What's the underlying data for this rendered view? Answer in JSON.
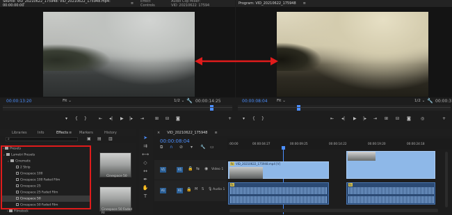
{
  "source_monitor": {
    "tabs": [
      "Source: VID_20210622_175948: VID_20210622_175948.mp4: 00:00:00:00",
      "Effect Controls",
      "Audio Clip Mixer: VID_20210622_17594"
    ],
    "timecode_current": "00:00:13:20",
    "fit": "Fit",
    "resolution": "1/2",
    "timecode_duration": "00:00:14:25"
  },
  "program_monitor": {
    "title": "Program: VID_20210622_175948",
    "timecode_current": "00:00:08:04",
    "fit": "Fit",
    "resolution": "1/2",
    "timecode_duration": "00:00:3"
  },
  "arrow_color": "#e01b1b",
  "effects_panel": {
    "tabs": [
      "Libraries",
      "Info",
      "Effects",
      "Markers",
      "History"
    ],
    "tree": [
      {
        "label": "Presets",
        "level": 0,
        "type": "folder"
      },
      {
        "label": "Lumetri Presets",
        "level": 0,
        "type": "folder"
      },
      {
        "label": "Cinematic",
        "level": 1,
        "type": "folder"
      },
      {
        "label": "2 Strip",
        "level": 2,
        "type": "preset"
      },
      {
        "label": "Cinespace 100",
        "level": 2,
        "type": "preset"
      },
      {
        "label": "Cinespace 100 Faded Film",
        "level": 2,
        "type": "preset"
      },
      {
        "label": "Cinespace 25",
        "level": 2,
        "type": "preset"
      },
      {
        "label": "Cinespace 25 Faded Film",
        "level": 2,
        "type": "preset"
      },
      {
        "label": "Cinespace 50",
        "level": 2,
        "type": "preset"
      },
      {
        "label": "Cinespace 50 Faded Film",
        "level": 2,
        "type": "preset"
      },
      {
        "label": "Filmstock",
        "level": 1,
        "type": "folder"
      }
    ],
    "preview_labels": [
      "Cinespace 50",
      "Cinespace 50 Faded Fil"
    ],
    "highlight_color": "#e01b1b"
  },
  "timeline": {
    "title": "VID_20210622_175948",
    "timecode": "00:00:08:04",
    "ruler": [
      ":00:00",
      "00:00:04:27",
      "00:00:09:25",
      "00:00:14:22",
      "00:00:19:20",
      "00:00:24:18"
    ],
    "tracks": [
      {
        "id": "V1",
        "name": "Video 1"
      },
      {
        "id": "A1",
        "name": "Audio 1"
      }
    ],
    "clip_label": "VID_20210622_175948.mp4 [V]",
    "clip_fx": "fx"
  }
}
